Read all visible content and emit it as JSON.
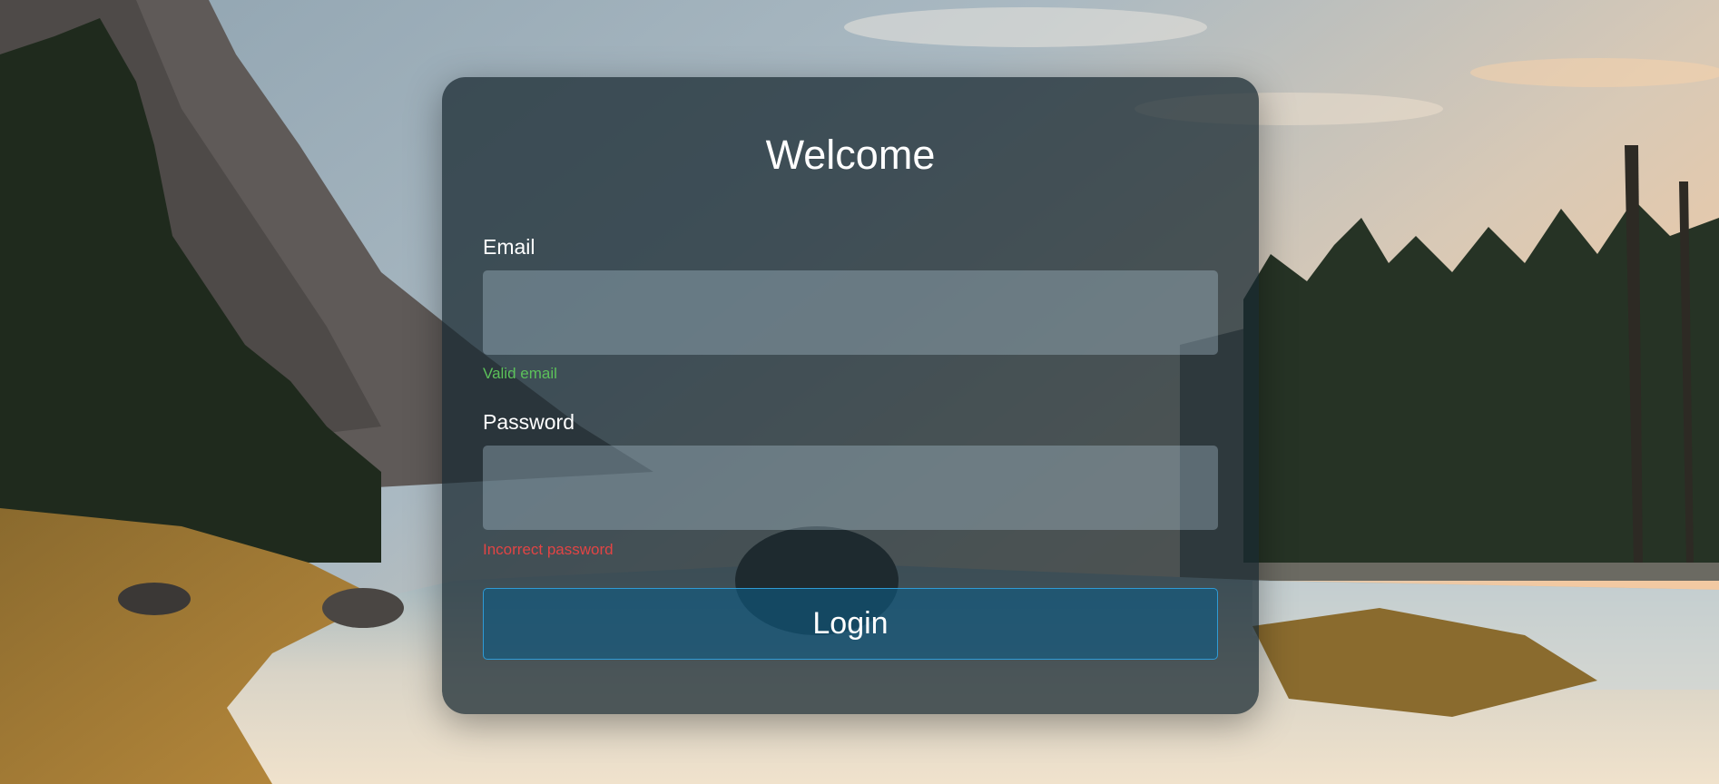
{
  "theme": {
    "success_color": "#5cc15a",
    "error_color": "#e24444",
    "button_border": "#2e9bd6"
  },
  "login_form": {
    "title": "Welcome",
    "email": {
      "label": "Email",
      "value": "",
      "placeholder": "",
      "validation_message": "Valid email",
      "validation_state": "success"
    },
    "password": {
      "label": "Password",
      "value": "",
      "placeholder": "",
      "validation_message": "Incorrect password",
      "validation_state": "error"
    },
    "submit_label": "Login"
  }
}
